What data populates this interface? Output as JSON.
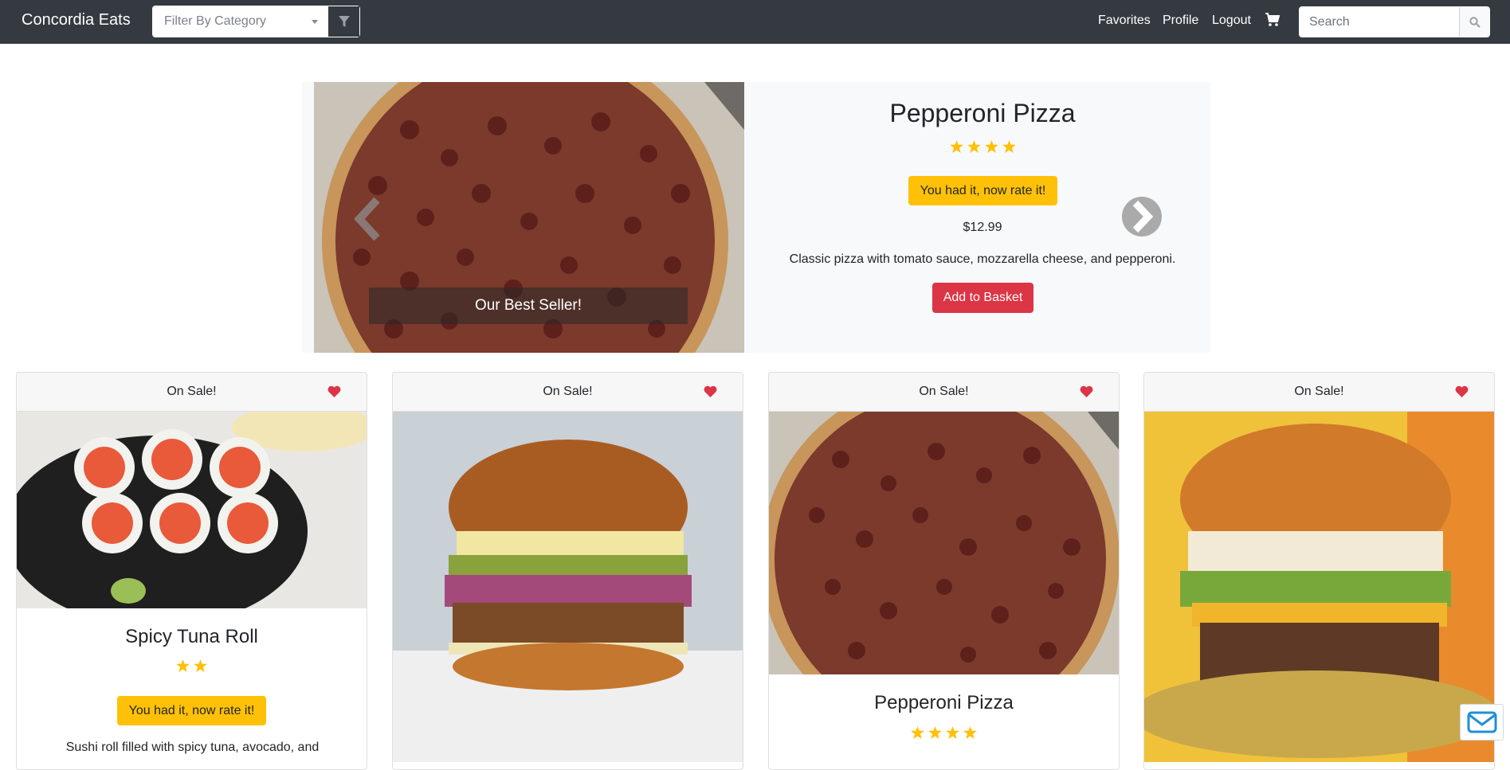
{
  "navbar": {
    "brand": "Concordia Eats",
    "filter_placeholder": "Filter By Category",
    "links": [
      "Favorites",
      "Profile",
      "Logout"
    ],
    "search_placeholder": "Search"
  },
  "hero": {
    "caption": "Our Best Seller!",
    "title": "Pepperoni Pizza",
    "rating": 4,
    "rate_label": "You had it, now rate it!",
    "price": "$12.99",
    "description": "Classic pizza with tomato sauce, mozzarella cheese, and pepperoni.",
    "basket_label": "Add to Basket"
  },
  "cards": [
    {
      "badge": "On Sale!",
      "title": "Spicy Tuna Roll",
      "rating": 2,
      "rate_label": "You had it, now rate it!",
      "description": "Sushi roll filled with spicy tuna, avocado, and"
    },
    {
      "badge": "On Sale!"
    },
    {
      "badge": "On Sale!",
      "title": "Pepperoni Pizza",
      "rating": 4
    },
    {
      "badge": "On Sale!"
    }
  ],
  "colors": {
    "navbar": "#343a40",
    "warning": "#ffc107",
    "danger": "#dc3545",
    "heart": "#dc3545",
    "star": "#ffc107"
  }
}
